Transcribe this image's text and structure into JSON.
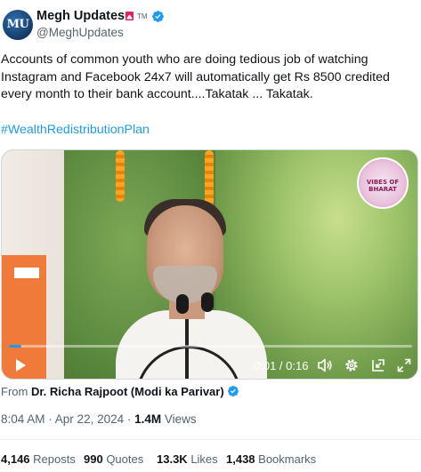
{
  "author": {
    "display_name": "Megh Updates",
    "flag_icon": "siren-flag-icon",
    "tm": "TM",
    "handle": "@MeghUpdates",
    "avatar_text": "MU",
    "verified_color": "#1d9bf0"
  },
  "tweet": {
    "lines": [
      "Accounts of common youth who are doing tedious job of watching",
      "Instagram and Facebook 24x7 will automatically get Rs 8500 credited",
      "every month to their bank account....Takatak ... Takatak."
    ],
    "hashtag": "#WealthRedistributionPlan"
  },
  "video": {
    "time_current": "0:01",
    "time_separator": " / ",
    "time_total": "0:16",
    "progress_fraction": 0.03,
    "watermark_text": "VIBES OF BHARAT",
    "accent_color": "#1d9bf0"
  },
  "source": {
    "prefix": "From ",
    "user": "Dr. Richa Rajpoot (Modi ka Parivar)"
  },
  "meta": {
    "time": "8:04 AM",
    "separator": " · ",
    "date": "Apr 22, 2024",
    "views_count": "1.4M",
    "views_label": " Views"
  },
  "stats": {
    "reposts_count": "4,146",
    "reposts_label": " Reposts",
    "quotes_count": "990",
    "quotes_label": " Quotes",
    "likes_count": "13.3K",
    "likes_label": " Likes",
    "bookmarks_count": "1,438",
    "bookmarks_label": " Bookmarks"
  }
}
